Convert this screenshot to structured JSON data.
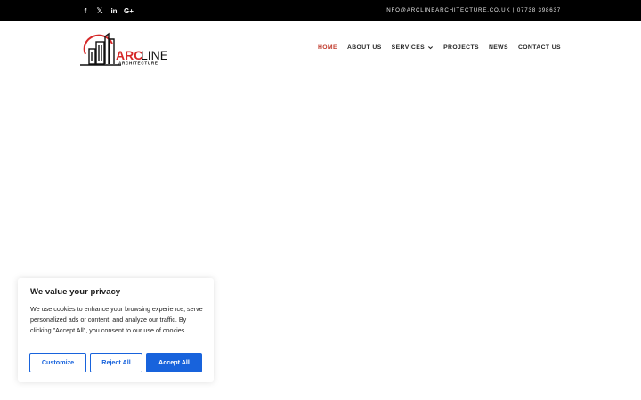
{
  "topbar": {
    "social": [
      {
        "name": "facebook-icon",
        "glyph": "f"
      },
      {
        "name": "x-icon",
        "glyph": "𝕏"
      },
      {
        "name": "linkedin-icon",
        "glyph": "in"
      },
      {
        "name": "google-plus-icon",
        "glyph": "G+"
      }
    ],
    "contact": "INFO@ARCLINEARCHITECTURE.CO.UK | 07738 398637"
  },
  "logo": {
    "word_bold": "ARC",
    "word_light": "LINE",
    "tagline": "ARCHITECTURE"
  },
  "nav": {
    "items": [
      "HOME",
      "ABOUT US",
      "SERVICES",
      "PROJECTS",
      "NEWS",
      "CONTACT US"
    ],
    "active": "HOME"
  },
  "cookie": {
    "title": "We value your privacy",
    "text": "We use cookies to enhance your browsing experience, serve personalized ads or content, and analyze our traffic. By clicking \"Accept All\", you consent to our use of cookies.",
    "customize": "Customize",
    "reject": "Reject All",
    "accept": "Accept All"
  },
  "colors": {
    "topbar": "#000000",
    "nav_active": "#c0392b",
    "accent": "#1863dc",
    "logo_red": "#d62828"
  }
}
